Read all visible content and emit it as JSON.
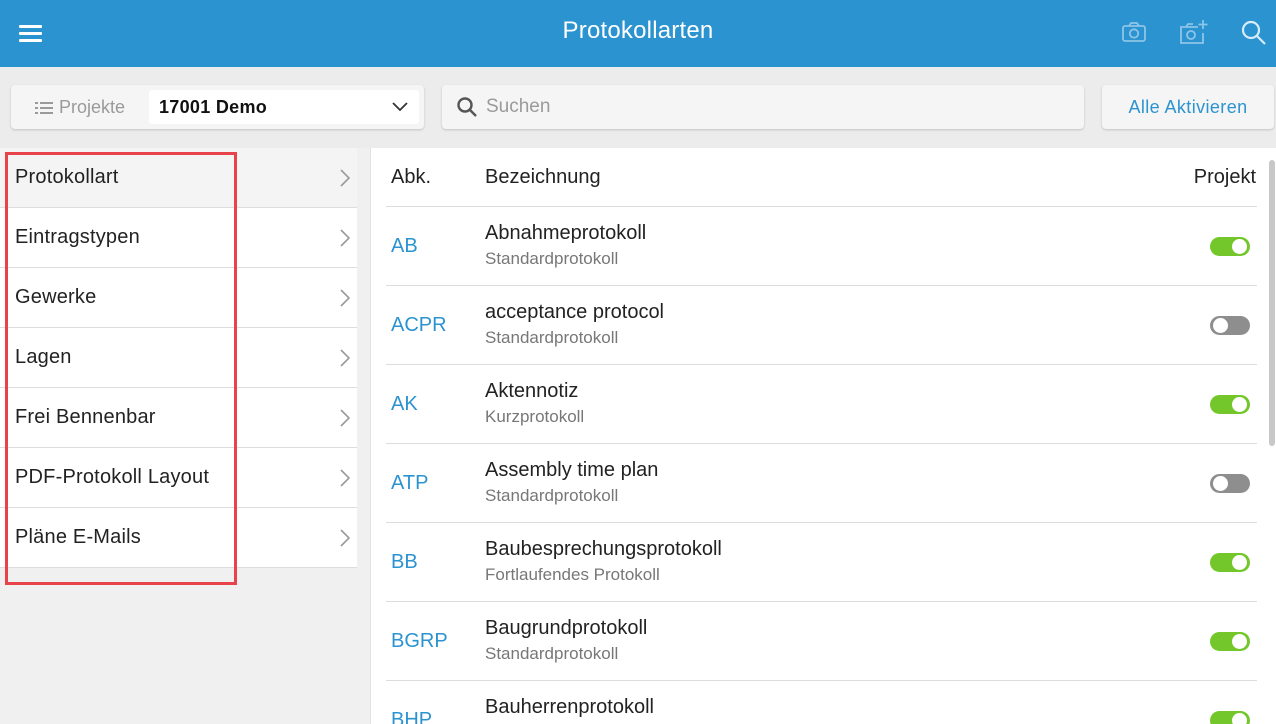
{
  "header": {
    "title": "Protokollarten",
    "menu_icon": "menu-icon",
    "actions": [
      "camera-icon",
      "camera-add-icon",
      "search-icon"
    ]
  },
  "toolbar": {
    "project_label": "Projekte",
    "project_value": "17001 Demo",
    "search_placeholder": "Suchen",
    "activate_all_label": "Alle Aktivieren"
  },
  "sidebar": {
    "items": [
      {
        "label": "Protokollart",
        "active": true
      },
      {
        "label": "Eintragstypen"
      },
      {
        "label": "Gewerke"
      },
      {
        "label": "Lagen"
      },
      {
        "label": "Frei Bennenbar"
      },
      {
        "label": "PDF-Protokoll Layout"
      },
      {
        "label": "Pläne E-Mails"
      }
    ]
  },
  "table": {
    "headers": {
      "abk": "Abk.",
      "bezeichnung": "Bezeichnung",
      "projekt": "Projekt"
    },
    "rows": [
      {
        "abk": "AB",
        "name": "Abnahmeprotokoll",
        "type": "Standardprotokoll",
        "enabled": true
      },
      {
        "abk": "ACPR",
        "name": "acceptance protocol",
        "type": "Standardprotokoll",
        "enabled": false
      },
      {
        "abk": "AK",
        "name": "Aktennotiz",
        "type": "Kurzprotokoll",
        "enabled": true
      },
      {
        "abk": "ATP",
        "name": "Assembly time plan",
        "type": "Standardprotokoll",
        "enabled": false
      },
      {
        "abk": "BB",
        "name": "Baubesprechungsprotokoll",
        "type": "Fortlaufendes Protokoll",
        "enabled": true
      },
      {
        "abk": "BGRP",
        "name": "Baugrundprotokoll",
        "type": "Standardprotokoll",
        "enabled": true
      },
      {
        "abk": "BHP",
        "name": "Bauherrenprotokoll",
        "type": "",
        "enabled": true
      }
    ]
  },
  "colors": {
    "primary": "#2b93cf",
    "toggle_on": "#74c72a",
    "toggle_off": "#8e8e8e",
    "highlight": "#e8434b"
  }
}
